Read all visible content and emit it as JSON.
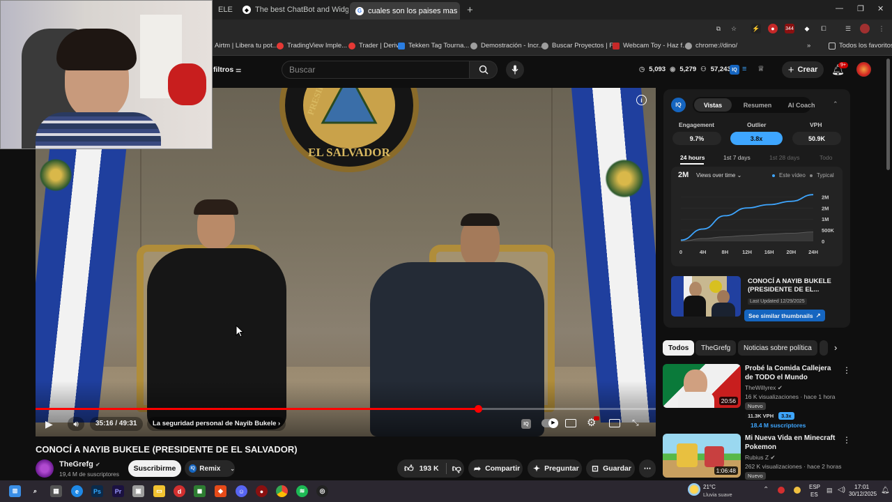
{
  "browser": {
    "tabs": [
      {
        "label": "ELE",
        "active": false
      },
      {
        "label": "The best ChatBot and Widgets",
        "active": false
      },
      {
        "label": "cuales son los paises mas segu",
        "active": true
      }
    ],
    "new_tab": "+",
    "window_controls": [
      "minimize",
      "restore",
      "close"
    ]
  },
  "bookmarks": [
    {
      "label": "Airtm | Libera tu pot...",
      "color": "#1f6feb"
    },
    {
      "label": "TradingView Imple...",
      "color": "#e53935"
    },
    {
      "label": "Trader | Deriv",
      "color": "#e53935"
    },
    {
      "label": "Tekken Tag Tourna...",
      "color": "#2a7de1"
    },
    {
      "label": "Demostración - Incr...",
      "color": "#9e9e9e"
    },
    {
      "label": "Buscar Proyectos | F...",
      "color": "#9e9e9e"
    },
    {
      "label": "Webcam Toy - Haz f...",
      "color": "#c62828"
    },
    {
      "label": "chrome://dino/",
      "color": "#9e9e9e"
    }
  ],
  "bookmarks_all": "Todos los favoritos",
  "youtube_header": {
    "filters_label": "filtros",
    "search_placeholder": "Buscar",
    "stats": [
      "5,093",
      "5,279",
      "57,243"
    ],
    "create_label": "Crear",
    "notif_count": "9+"
  },
  "player": {
    "time": "35:16 / 49:31",
    "chapter": "La seguridad personal de Nayib Bukele",
    "seal_text": "EL SALVADOR",
    "seal_top": "PRESIDENCIA",
    "progress": 0.713,
    "buffered": 0.71
  },
  "video": {
    "title": "CONOCÍ A NAYIB BUKELE (PRESIDENTE DE EL SALVADOR)",
    "channel": "TheGrefg",
    "subscribers": "19,4 M de suscriptores",
    "subscribe_label": "Suscribirme",
    "remix_label": "Remix",
    "likes": "193 K",
    "share_label": "Compartir",
    "ask_label": "Preguntar",
    "save_label": "Guardar"
  },
  "iq_panel": {
    "tabs": [
      "Vistas",
      "Resumen",
      "AI Coach"
    ],
    "metrics": [
      {
        "label": "Engagement",
        "value": "9.7%"
      },
      {
        "label": "Outlier",
        "value": "3.8x"
      },
      {
        "label": "VPH",
        "value": "50.9K"
      }
    ],
    "ranges": [
      "24 hours",
      "1st 7 days",
      "1st 28 days",
      "Todo"
    ],
    "chart_total": "2M",
    "chart_mode": "Views over time",
    "legend": [
      "Este vídeo",
      "Typical"
    ],
    "thumb_title": "CONOCÍ A NAYIB BUKELE (PRESIDENTE DE EL...",
    "last_updated": "Last Updated 12/29/2025",
    "similar_label": "See similar thumbnails"
  },
  "chart_data": {
    "type": "line",
    "x": [
      "0",
      "4H",
      "8H",
      "12H",
      "16H",
      "20H",
      "24H"
    ],
    "y_ticks": [
      "0",
      "500K",
      "1M",
      "2M",
      "2M"
    ],
    "series": [
      {
        "name": "Este vídeo",
        "values": [
          0.05,
          0.55,
          1.15,
          1.5,
          1.65,
          1.8,
          2.1
        ]
      },
      {
        "name": "Typical",
        "values": [
          0.0,
          0.12,
          0.2,
          0.26,
          0.32,
          0.36,
          0.42
        ]
      }
    ],
    "ylim": [
      0,
      2.2
    ],
    "colors": {
      "Este vídeo": "#3ea6ff",
      "Typical": "#5a5a5a"
    }
  },
  "chips": [
    "Todos",
    "TheGrefg",
    "Noticias sobre política"
  ],
  "recommendations": [
    {
      "title": "Probé la Comida Callejera de TODO el Mundo",
      "channel": "TheWillyrex",
      "meta": "16 K visualizaciones · hace 1 hora",
      "badge": "Nuevo",
      "vph": "11.3K VPH",
      "outlier": "3.3x",
      "subs": "18.4 M suscriptores",
      "duration": "20:56"
    },
    {
      "title": "Mi Nueva Vida en Minecraft Pokemon",
      "channel": "Rubius Z",
      "meta": "262 K visualizaciones · hace 2 horas",
      "badge": "Nuevo",
      "duration": "1:06:48"
    }
  ],
  "taskbar": {
    "weather_temp": "21°C",
    "weather_desc": "Lluvia suave",
    "lang": "ESP",
    "lang2": "ES",
    "time": "17:01",
    "date": "30/12/2025"
  }
}
